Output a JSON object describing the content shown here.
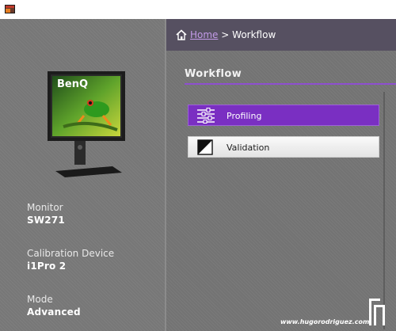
{
  "header": {
    "home_link": "Home",
    "separator": ">",
    "current": "Workflow"
  },
  "left": {
    "monitor_label": "Monitor",
    "monitor_value": "SW271",
    "calibration_label": "Calibration Device",
    "calibration_value": "i1Pro 2",
    "mode_label": "Mode",
    "mode_value": "Advanced",
    "monitor_brand": "BenQ"
  },
  "main": {
    "section_title": "Workflow",
    "buttons": [
      {
        "label": "Profiling",
        "icon": "sliders-icon",
        "selected": true
      },
      {
        "label": "Validation",
        "icon": "validation-icon",
        "selected": false
      }
    ]
  },
  "watermark": "www.hugorodriguez.com",
  "colors": {
    "accent": "#7a2fc2",
    "header_bg": "#565061",
    "link": "#c39be8"
  }
}
